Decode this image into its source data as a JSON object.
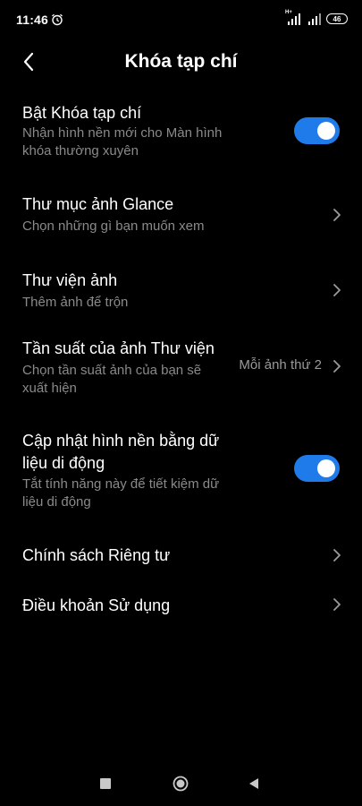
{
  "status_bar": {
    "time": "11:46",
    "network_label": "H+",
    "battery": "46"
  },
  "header": {
    "title": "Khóa tạp chí"
  },
  "settings": {
    "enable_lock": {
      "title": "Bật Khóa tạp chí",
      "subtitle_line1": "Nhận hình nền mới cho Màn hình",
      "subtitle_line2": "khóa thường xuyên",
      "toggle_on": true
    },
    "glance_folders": {
      "title": "Thư mục ảnh Glance",
      "subtitle": "Chọn những gì bạn muốn xem"
    },
    "gallery": {
      "title": "Thư viện ảnh",
      "subtitle": "Thêm ảnh để trộn"
    },
    "gallery_frequency": {
      "title": "Tần suất của ảnh Thư viện",
      "subtitle_line1": "Chọn tần suất ảnh của bạn sẽ",
      "subtitle_line2": "xuất hiện",
      "value": "Mỗi ảnh thứ 2"
    },
    "mobile_data_update": {
      "title_line1": "Cập nhật hình nền bằng dữ",
      "title_line2": "liệu di động",
      "subtitle_line1": "Tắt tính năng này để tiết kiệm dữ",
      "subtitle_line2": "liệu di động",
      "toggle_on": true
    },
    "privacy_policy": {
      "title": "Chính sách Riêng tư"
    },
    "terms_of_use": {
      "title": "Điều khoản Sử dụng"
    }
  },
  "colors": {
    "background": "#000000",
    "accent": "#1f7bea",
    "secondary_text": "#8a8a8a"
  },
  "icons": {
    "back": "back-arrow-icon",
    "chevron": "chevron-right-icon",
    "alarm": "alarm-icon",
    "nav_recents": "square-icon",
    "nav_home": "circle-icon",
    "nav_back": "triangle-icon"
  }
}
